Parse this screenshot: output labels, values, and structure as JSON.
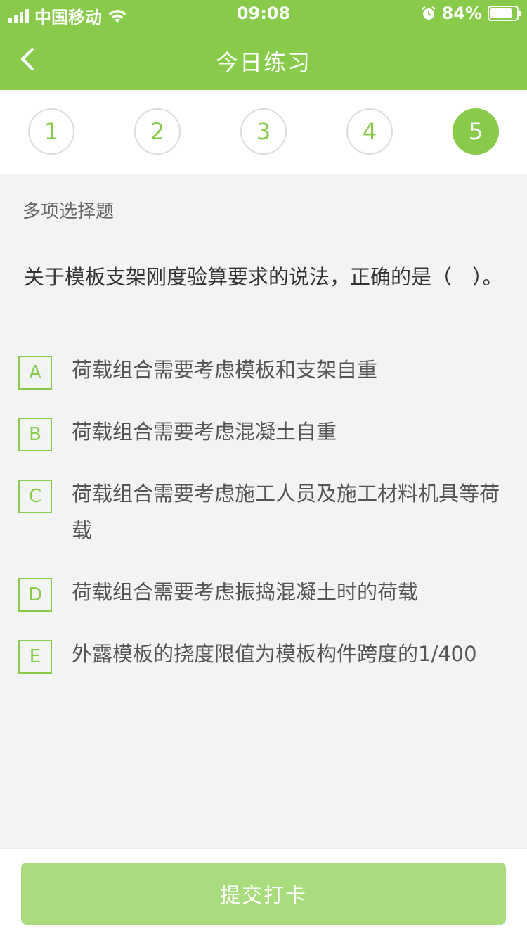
{
  "status": {
    "carrier": "中国移动",
    "time": "09:08",
    "battery": "84%",
    "battery_level": 0.84
  },
  "header": {
    "title": "今日练习"
  },
  "steps": [
    {
      "label": "1"
    },
    {
      "label": "2"
    },
    {
      "label": "3"
    },
    {
      "label": "4"
    },
    {
      "label": "5"
    }
  ],
  "active_step": 4,
  "question_type": "多项选择题",
  "question": "关于模板支架刚度验算要求的说法，正确的是（　）。",
  "options": [
    {
      "letter": "A",
      "text": "荷载组合需要考虑模板和支架自重"
    },
    {
      "letter": "B",
      "text": "荷载组合需要考虑混凝土自重"
    },
    {
      "letter": "C",
      "text": "荷载组合需要考虑施工人员及施工材料机具等荷载"
    },
    {
      "letter": "D",
      "text": "荷载组合需要考虑振捣混凝土时的荷载"
    },
    {
      "letter": "E",
      "text": "外露模板的挠度限值为模板构件跨度的1/400"
    }
  ],
  "submit_label": "提交打卡",
  "colors": {
    "accent": "#88cb4a",
    "submit_disabled": "#a8dc7c"
  }
}
